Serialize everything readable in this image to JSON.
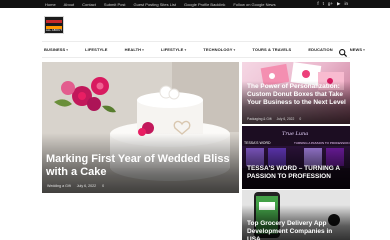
{
  "topbar": {
    "links": [
      "Home",
      "About",
      "Contact",
      "Submit Post",
      "Guest Posting Sites List",
      "Google Profile Backlink",
      "Follow on Google News"
    ],
    "social": [
      "f",
      "t",
      "g+",
      "▶",
      "in"
    ]
  },
  "logo": {
    "text": "ALL ABOUT"
  },
  "nav": {
    "items": [
      {
        "label": "BUSINESS",
        "dropdown": true
      },
      {
        "label": "LIFESTYLE",
        "dropdown": false
      },
      {
        "label": "HEALTH",
        "dropdown": true
      },
      {
        "label": "LIFESTYLE",
        "dropdown": true
      },
      {
        "label": "TECHNOLOGY",
        "dropdown": true
      },
      {
        "label": "TOURS & TRAVELS",
        "dropdown": false
      },
      {
        "label": "EDUCATION",
        "dropdown": false
      },
      {
        "label": "NEWS",
        "dropdown": true
      }
    ],
    "chevron": "▾",
    "search_icon": "search-icon"
  },
  "hero": {
    "title": "Marking First Year of Wedded Bliss with a Cake",
    "meta": [
      "Wedding a Gift",
      "July 6, 2022",
      "0"
    ]
  },
  "cards": [
    {
      "title": "The Power of Personalization: Custom Donut Boxes that Take Your Business to the Next Level",
      "meta": [
        "Packaging & Gift",
        "July 6, 2022",
        "0"
      ]
    },
    {
      "title": "TESSA'S WORD – TURNING A PASSION TO PROFESSION",
      "overlay": "True Luna",
      "banner": [
        "TESSA'S WORD",
        "TURNING A PASSION TO PROFESSION"
      ]
    },
    {
      "title": "Top Grocery Delivery App Development Companies in USA"
    }
  ],
  "colors": {
    "topbar": "#111111",
    "accent": "#c62828",
    "text_dark": "#1a1a1a"
  }
}
